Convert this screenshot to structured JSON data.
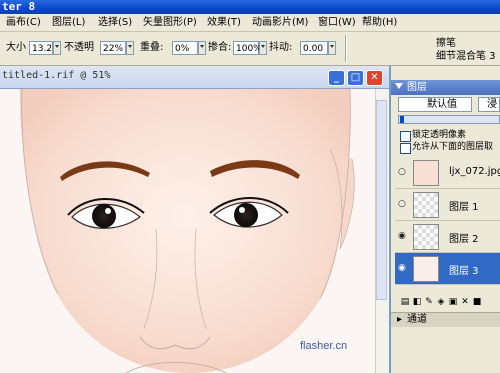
{
  "app": {
    "title": "ter 8"
  },
  "menu": [
    {
      "label": "画布(C)"
    },
    {
      "label": "图层(L)"
    },
    {
      "label": "选择(S)"
    },
    {
      "label": "矢量图形(P)"
    },
    {
      "label": "效果(T)"
    },
    {
      "label": "动画影片(M)"
    },
    {
      "label": "窗口(W)"
    },
    {
      "label": "帮助(H)"
    }
  ],
  "options": {
    "size_label": "大小",
    "size_value": "13.2",
    "opacity_label": "不透明",
    "opacity_value": "22%",
    "overlap_label": "重叠:",
    "overlap_value": "0%",
    "blend_label": "掺合:",
    "blend_value": "100%",
    "jitter_label": "抖动:",
    "jitter_value": "0.00",
    "brush_category": "擦笔",
    "brush_variant": "细节混合笔 3"
  },
  "document": {
    "title": "titled-1.rif @ 51%",
    "watermark": "flasher.cn"
  },
  "layers_panel": {
    "title": "图层",
    "composite_method": "默认值",
    "second_combo": "浸",
    "preserve_transparency": "锁定透明像素",
    "pick_up_underlying": "允许从下面的图层取",
    "layers": [
      {
        "name": "ljx_072.jpg",
        "visible": false,
        "selected": false
      },
      {
        "name": "图层 1",
        "visible": false,
        "selected": false
      },
      {
        "name": "图层 2",
        "visible": true,
        "selected": false
      },
      {
        "name": "图层 3",
        "visible": true,
        "selected": true
      }
    ],
    "channels_label": "通道"
  },
  "colors": {
    "selection": "#316ac5",
    "title_blue": "#0a48c8",
    "close_red": "#e0442a"
  },
  "icons": [
    "minimize-icon",
    "maximize-icon",
    "close-icon",
    "eye-icon",
    "brush-icon",
    "layer-tool-icons"
  ]
}
